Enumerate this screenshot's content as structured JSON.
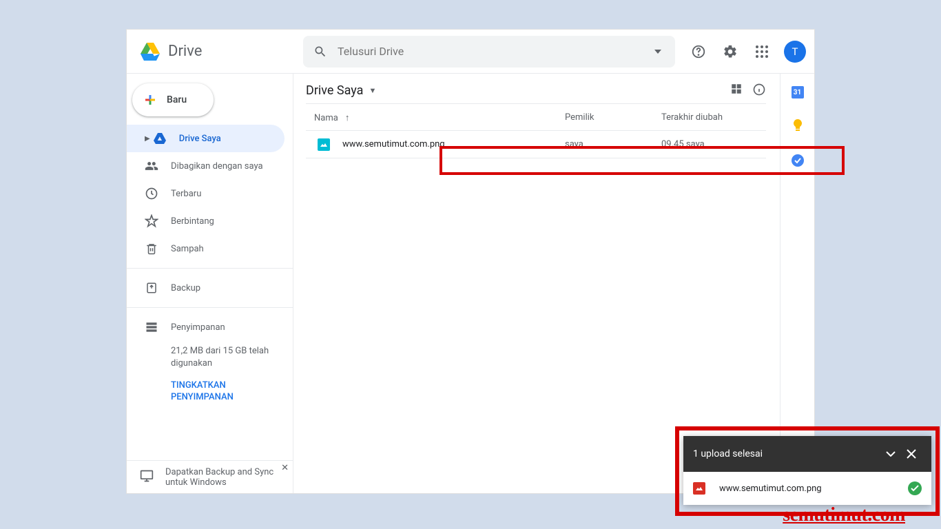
{
  "header": {
    "app_name": "Drive",
    "search_placeholder": "Telusuri Drive",
    "avatar_initial": "T"
  },
  "sidebar": {
    "new_button": "Baru",
    "items": [
      {
        "label": "Drive Saya"
      },
      {
        "label": "Dibagikan dengan saya"
      },
      {
        "label": "Terbaru"
      },
      {
        "label": "Berbintang"
      },
      {
        "label": "Sampah"
      }
    ],
    "backup_label": "Backup",
    "storage_label": "Penyimpanan",
    "storage_usage": "21,2 MB dari 15 GB telah digunakan",
    "upgrade_label": "TINGKATKAN PENYIMPANAN",
    "promo_text": "Dapatkan Backup and Sync untuk Windows"
  },
  "main": {
    "breadcrumb": "Drive Saya",
    "columns": {
      "name": "Nama",
      "owner": "Pemilik",
      "modified": "Terakhir diubah"
    },
    "files": [
      {
        "name": "www.semutimut.com.png",
        "owner": "saya",
        "modified_time": "09.45",
        "modified_by": "saya"
      }
    ]
  },
  "toast": {
    "title": "1 upload selesai",
    "filename": "www.semutimut.com.png"
  },
  "watermark": "semutimut.com"
}
